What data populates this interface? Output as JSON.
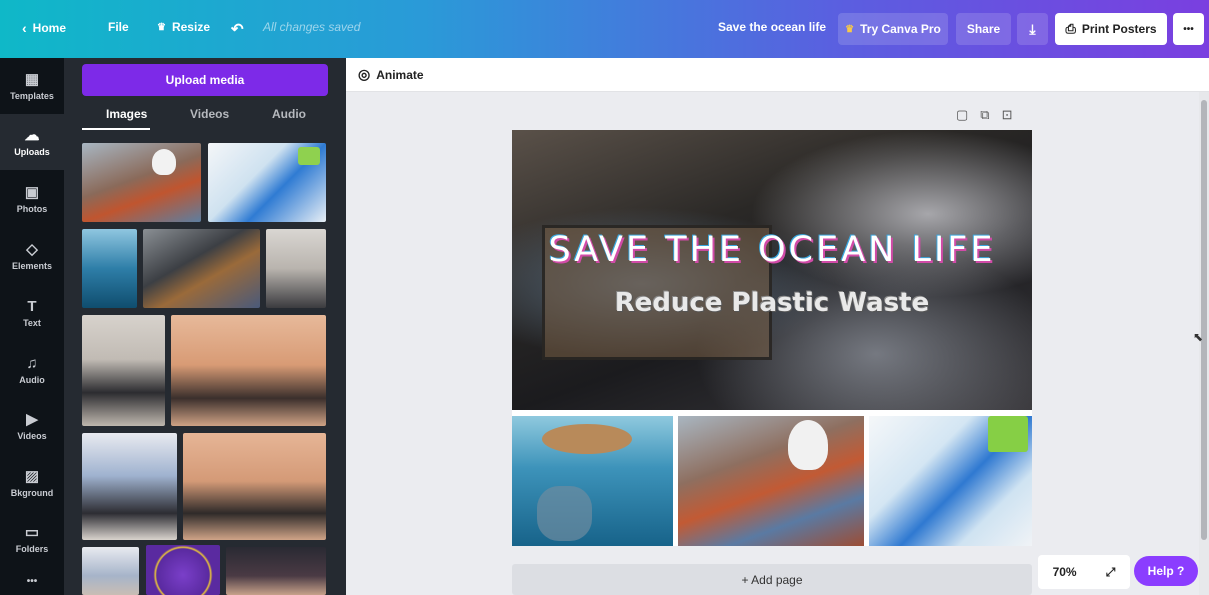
{
  "topbar": {
    "home_label": "Home",
    "file_label": "File",
    "resize_label": "Resize",
    "saved_status": "All changes saved",
    "design_title": "Save the ocean life",
    "try_pro_label": "Try Canva Pro",
    "share_label": "Share",
    "print_label": "Print Posters",
    "more_label": "•••"
  },
  "rail": {
    "items": [
      {
        "label": "Templates",
        "icon": "▦"
      },
      {
        "label": "Uploads",
        "icon": "☁"
      },
      {
        "label": "Photos",
        "icon": "▣"
      },
      {
        "label": "Elements",
        "icon": "◇"
      },
      {
        "label": "Text",
        "icon": "T"
      },
      {
        "label": "Audio",
        "icon": "♫"
      },
      {
        "label": "Videos",
        "icon": "▶"
      },
      {
        "label": "Bkground",
        "icon": "▨"
      },
      {
        "label": "Folders",
        "icon": "▭"
      },
      {
        "label": "•••",
        "icon": ""
      }
    ]
  },
  "panel": {
    "upload_label": "Upload media",
    "tabs": [
      {
        "label": "Images"
      },
      {
        "label": "Videos"
      },
      {
        "label": "Audio"
      }
    ]
  },
  "toolbar": {
    "animate_label": "Animate"
  },
  "canvas": {
    "hero_title": "SAVE THE OCEAN LIFE",
    "hero_subtitle": "Reduce Plastic Waste",
    "add_page_label": "+ Add page"
  },
  "footer": {
    "zoom": "70%",
    "help_label": "Help ?"
  },
  "colors": {
    "accent": "#7d2ae8",
    "help": "#8b3dff",
    "panel": "#252a31",
    "rail": "#0e1318"
  }
}
